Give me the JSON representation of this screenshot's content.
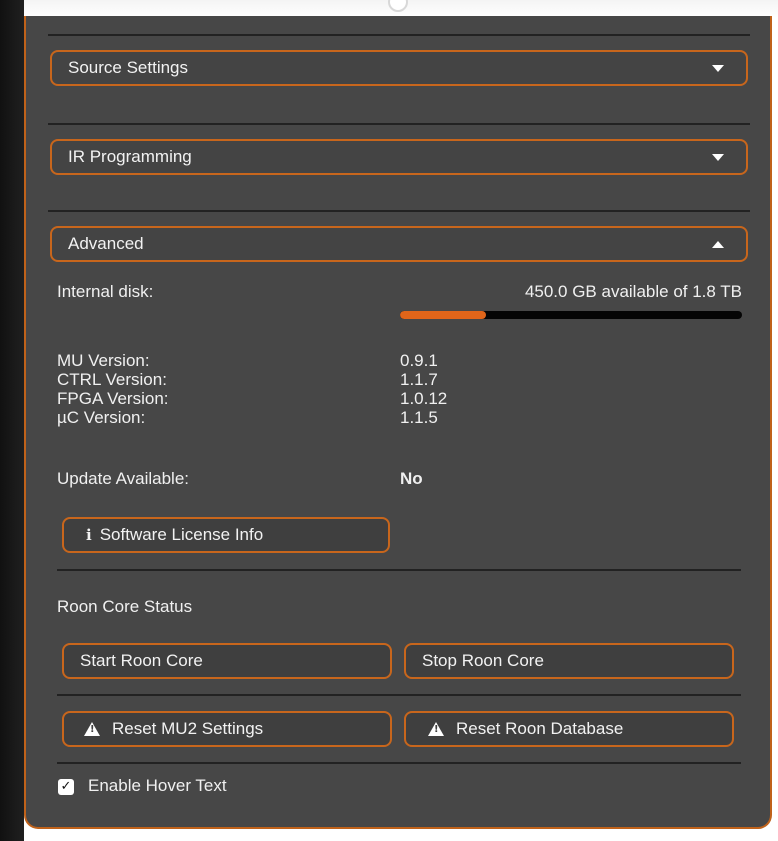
{
  "sections": [
    {
      "label": "Source Settings",
      "expanded": false
    },
    {
      "label": "IR Programming",
      "expanded": false
    },
    {
      "label": "Advanced",
      "expanded": true
    }
  ],
  "disk": {
    "label": "Internal disk:",
    "summary": "450.0 GB available of 1.8 TB",
    "used_fraction": 0.25,
    "bar_color": "#e0651a"
  },
  "versions": [
    {
      "label": "MU Version:",
      "value": "0.9.1"
    },
    {
      "label": "CTRL Version:",
      "value": "1.1.7"
    },
    {
      "label": "FPGA Version:",
      "value": "1.0.12"
    },
    {
      "label": "µC Version:",
      "value": "1.1.5"
    }
  ],
  "update": {
    "label": "Update Available:",
    "value": "No"
  },
  "license_button": {
    "label": "Software License Info",
    "icon": "info-icon"
  },
  "roon": {
    "heading": "Roon Core Status",
    "start_label": "Start Roon Core",
    "stop_label": "Stop Roon Core"
  },
  "reset": {
    "mu2_label": "Reset MU2 Settings",
    "db_label": "Reset Roon Database",
    "icon": "warning-icon"
  },
  "hover_text": {
    "label": "Enable Hover Text",
    "checked": true
  },
  "colors": {
    "accent": "#c8661c",
    "panel": "#474747",
    "divider": "#222222"
  }
}
